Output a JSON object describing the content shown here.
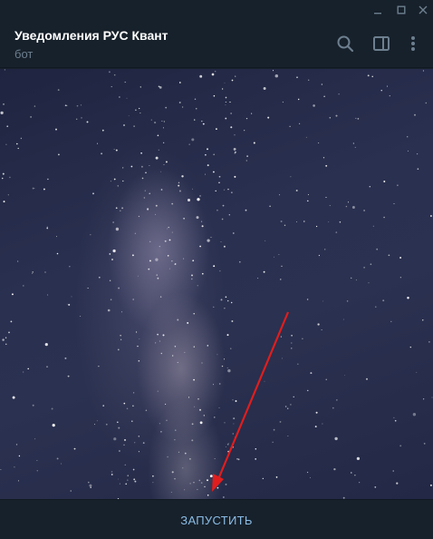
{
  "window": {
    "controls": [
      "minimize-icon",
      "maximize-icon",
      "close-icon"
    ]
  },
  "header": {
    "title": "Уведомления РУС Квант",
    "subtitle": "бот",
    "icons": [
      "search-icon",
      "sidebar-panel-icon",
      "more-vertical-icon"
    ]
  },
  "chat": {
    "background": "starry-sky-wallpaper",
    "annotation": "red-arrow-pointing-down"
  },
  "bottom": {
    "start_label": "ЗАПУСТИТЬ"
  },
  "colors": {
    "background": "#17212b",
    "title": "#ffffff",
    "subtitle": "#6d7f8f",
    "icon": "#6d7f8f",
    "accent": "#8bbde6",
    "arrow": "#e11d1d"
  }
}
